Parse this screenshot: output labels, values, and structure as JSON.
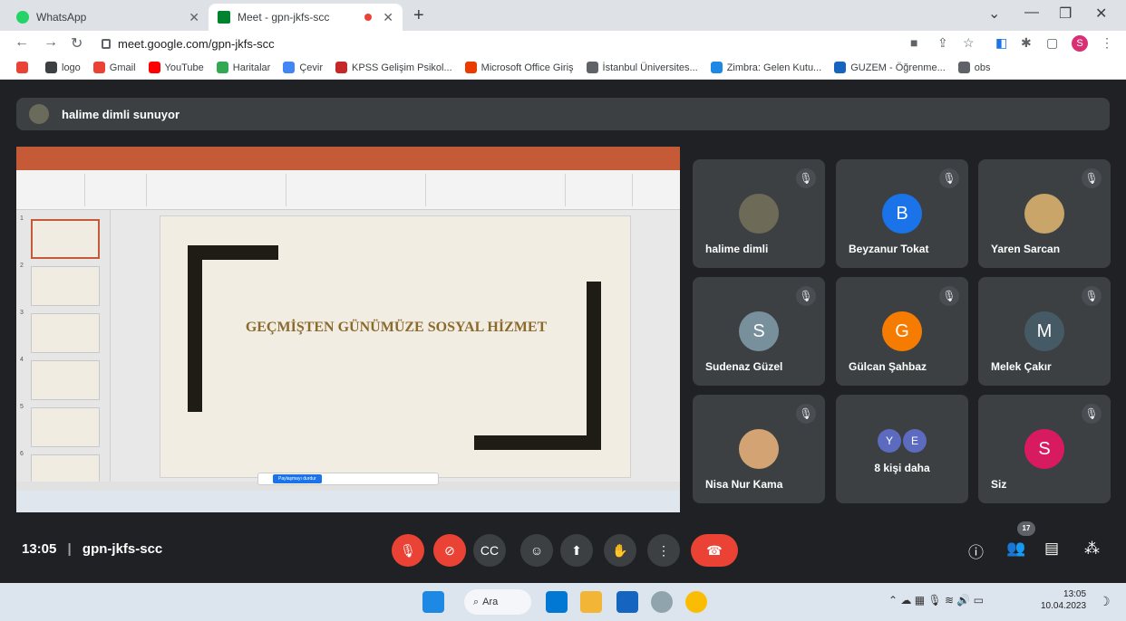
{
  "browser": {
    "tabs": [
      {
        "label": "WhatsApp",
        "active": false
      },
      {
        "label": "Meet - gpn-jkfs-scc",
        "active": true
      }
    ],
    "url": "meet.google.com/gpn-jkfs-scc",
    "profile_initial": "S",
    "bookmarks": [
      {
        "label": "",
        "color": "#ea4335"
      },
      {
        "label": "logo",
        "color": "#3c4043"
      },
      {
        "label": "Gmail",
        "color": "#ea4335"
      },
      {
        "label": "YouTube",
        "color": "#ff0000"
      },
      {
        "label": "Haritalar",
        "color": "#34a853"
      },
      {
        "label": "Çevir",
        "color": "#4285f4"
      },
      {
        "label": "KPSS Gelişim Psikol...",
        "color": "#c62828"
      },
      {
        "label": "Microsoft Office Giriş",
        "color": "#eb3c00"
      },
      {
        "label": "İstanbul Üniversites...",
        "color": "#5f6368"
      },
      {
        "label": "Zimbra: Gelen Kutu...",
        "color": "#1e88e5"
      },
      {
        "label": "GUZEM - Öğrenme...",
        "color": "#1565c0"
      },
      {
        "label": "obs",
        "color": "#5f6368"
      }
    ]
  },
  "meet": {
    "presenter_label": "halime dimli sunuyor",
    "meeting_time": "13:05",
    "meeting_code": "gpn-jkfs-scc",
    "participant_count": "17",
    "tiles": [
      {
        "name": "halime dimli",
        "initial": "",
        "color": "#6d6a58"
      },
      {
        "name": "Beyzanur Tokat",
        "initial": "B",
        "color": "#1a73e8"
      },
      {
        "name": "Yaren Sarcan",
        "initial": "",
        "color": "#c9a56a"
      },
      {
        "name": "Sudenaz Güzel",
        "initial": "S",
        "color": "#78909c"
      },
      {
        "name": "Gülcan Şahbaz",
        "initial": "G",
        "color": "#f57c00"
      },
      {
        "name": "Melek Çakır",
        "initial": "M",
        "color": "#455a64"
      },
      {
        "name": "Nisa Nur Kama",
        "initial": "",
        "color": "#d4a373"
      },
      {
        "name": "8 kişi daha",
        "initial": "",
        "color": "#5c6bc0"
      },
      {
        "name": "Siz",
        "initial": "S",
        "color": "#d81b60"
      }
    ],
    "more_avatars": [
      "Y",
      "E"
    ]
  },
  "shared_screen": {
    "slide_title": "GEÇMİŞTEN GÜNÜMÜZE SOSYAL HİZMET",
    "slide_numbers": [
      "1",
      "2",
      "3",
      "4",
      "5",
      "6"
    ],
    "share_button": "Paylaşmayı durdur"
  },
  "taskbar": {
    "search_label": "Ara",
    "time": "13:05",
    "date": "10.04.2023"
  }
}
